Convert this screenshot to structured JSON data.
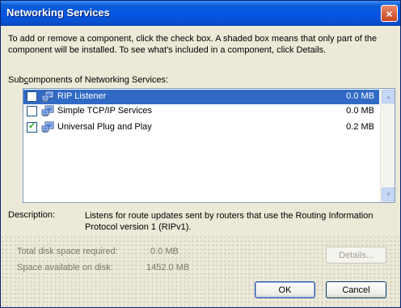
{
  "window": {
    "title": "Networking Services",
    "close": "×"
  },
  "intro": "To add or remove a component, click the check box. A shaded box means that only part of the component will be installed. To see what's included in a component, click Details.",
  "subcomponents": {
    "label_pre": "Sub",
    "label_ul": "c",
    "label_post": "omponents of Networking Services:"
  },
  "items": [
    {
      "label": "RIP Listener",
      "size": "0.0 MB",
      "checked": false,
      "selected": true
    },
    {
      "label": "Simple TCP/IP Services",
      "size": "0.0 MB",
      "checked": false,
      "selected": false
    },
    {
      "label": "Universal Plug and Play",
      "size": "0.2 MB",
      "checked": true,
      "selected": false
    }
  ],
  "description": {
    "label": "Description:",
    "text": "Listens for route updates sent by routers that use the Routing Information Protocol version 1 (RIPv1)."
  },
  "space": {
    "required_label": "Total disk space required:",
    "required_value": "0.0 MB",
    "available_label": "Space available on disk:",
    "available_value": "1452.0 MB"
  },
  "buttons": {
    "details": "Details...",
    "ok": "OK",
    "cancel": "Cancel"
  }
}
